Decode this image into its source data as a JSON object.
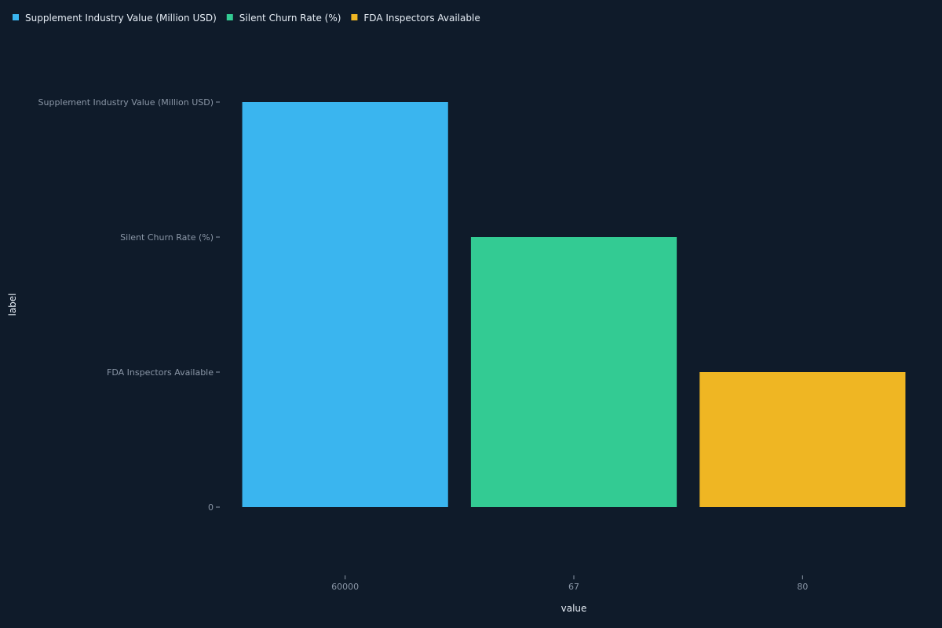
{
  "chart_data": {
    "type": "bar",
    "title": "",
    "xlabel": "value",
    "ylabel": "label",
    "categories": [
      "60000",
      "67",
      "80"
    ],
    "series": [
      {
        "name": "Supplement Industry Value (Million USD)",
        "color": "#3ab5ef",
        "category": "60000",
        "value": 3
      },
      {
        "name": "Silent Churn Rate (%)",
        "color": "#33cb93",
        "category": "67",
        "value": 2
      },
      {
        "name": "FDA Inspectors Available",
        "color": "#efb623",
        "category": "80",
        "value": 1
      }
    ],
    "yticks": [
      {
        "label": "0",
        "value": 0
      },
      {
        "label": "FDA Inspectors Available",
        "value": 1
      },
      {
        "label": "Silent Churn Rate (%)",
        "value": 2
      },
      {
        "label": "Supplement Industry Value (Million USD)",
        "value": 3
      }
    ],
    "ylim": [
      0,
      3
    ],
    "grid": false,
    "legend_position": "top-left",
    "background": "#0f1b2a"
  }
}
